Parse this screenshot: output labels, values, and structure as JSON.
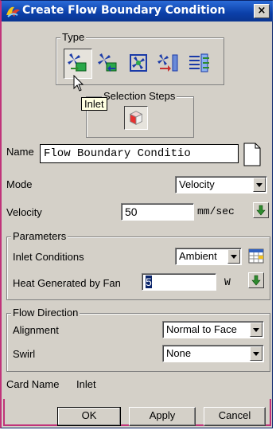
{
  "window": {
    "title": "Create Flow Boundary Condition",
    "close_label": "×"
  },
  "type_group": {
    "legend": "Type",
    "icons": [
      {
        "name": "inlet-fan-icon",
        "selected": true
      },
      {
        "name": "outlet-fan-icon",
        "selected": false
      },
      {
        "name": "internal-fan-icon",
        "selected": false
      },
      {
        "name": "vent-icon",
        "selected": false
      },
      {
        "name": "opening-icon",
        "selected": false
      }
    ],
    "tooltip": "Inlet"
  },
  "selection_steps": {
    "legend": "Selection Steps",
    "icon": "cube-face-icon"
  },
  "name": {
    "label": "Name",
    "value": "Flow Boundary Conditio"
  },
  "mode": {
    "label": "Mode",
    "value": "Velocity"
  },
  "velocity": {
    "label": "Velocity",
    "value": "50",
    "unit": "mm/sec"
  },
  "parameters": {
    "legend": "Parameters",
    "inlet_conditions": {
      "label": "Inlet Conditions",
      "value": "Ambient"
    },
    "heat": {
      "label": "Heat Generated by Fan",
      "value": "5",
      "unit": "W"
    }
  },
  "flow_direction": {
    "legend": "Flow Direction",
    "alignment": {
      "label": "Alignment",
      "value": "Normal to Face"
    },
    "swirl": {
      "label": "Swirl",
      "value": "None"
    }
  },
  "card_name": {
    "label": "Card Name",
    "value": "Inlet"
  },
  "buttons": {
    "ok": "OK",
    "apply": "Apply",
    "cancel": "Cancel"
  },
  "colors": {
    "title_bar": "#0b3fa8",
    "dialog_bg": "#d4d0c8",
    "accent_border": "#c0337a",
    "arrow_green": "#2e8b2e"
  }
}
